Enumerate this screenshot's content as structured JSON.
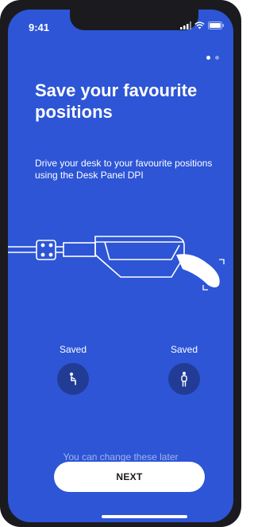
{
  "status_bar": {
    "time": "9:41"
  },
  "pagination": {
    "total": 2,
    "active_index": 0
  },
  "content": {
    "title": "Save your favourite positions",
    "description": "Drive your desk to your favourite positions using the Desk Panel DPI"
  },
  "positions": [
    {
      "label": "Saved",
      "icon": "sitting-person-icon"
    },
    {
      "label": "Saved",
      "icon": "standing-person-icon"
    }
  ],
  "footer": {
    "hint": "You can change these later",
    "next_label": "NEXT"
  },
  "colors": {
    "background": "#2d55d6",
    "position_button": "#223c95",
    "button": "#ffffff"
  }
}
